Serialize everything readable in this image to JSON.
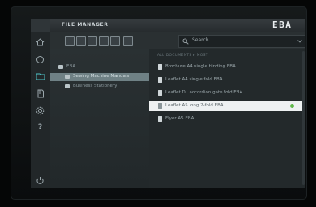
{
  "window": {
    "title": "FILE MANAGER",
    "brand": "EBA"
  },
  "sidebar": {
    "items": [
      {
        "icon": "home-icon"
      },
      {
        "icon": "circle-icon"
      },
      {
        "icon": "folder-icon"
      },
      {
        "icon": "document-icon"
      },
      {
        "icon": "gear-icon"
      },
      {
        "icon": "help-icon"
      },
      {
        "icon": "power-icon"
      }
    ]
  },
  "toolbar": {
    "tools": [
      "new-folder-icon",
      "copy-icon",
      "paste-icon",
      "cut-icon",
      "edit-icon",
      "delete-icon"
    ],
    "search_placeholder": "Search"
  },
  "folders": [
    {
      "label": "EBA"
    },
    {
      "label": "Sewing Machine Manuals",
      "selected": true
    },
    {
      "label": "Business Stationery"
    }
  ],
  "files": {
    "section_label": "ALL DOCUMENTS ▸ MOST",
    "items": [
      {
        "name": "Brochure A4 single binding.EBA"
      },
      {
        "name": "Leaflet A4 single fold.EBA"
      },
      {
        "name": "Leaflet DL accordion gate fold.EBA"
      },
      {
        "name": "Leaflet A5 long 2-fold.EBA",
        "selected": true,
        "status": "ok"
      },
      {
        "name": "Flyer A5.EBA"
      }
    ]
  },
  "colors": {
    "accent": "#4fc3c8",
    "status_ok": "#5fb84a"
  }
}
